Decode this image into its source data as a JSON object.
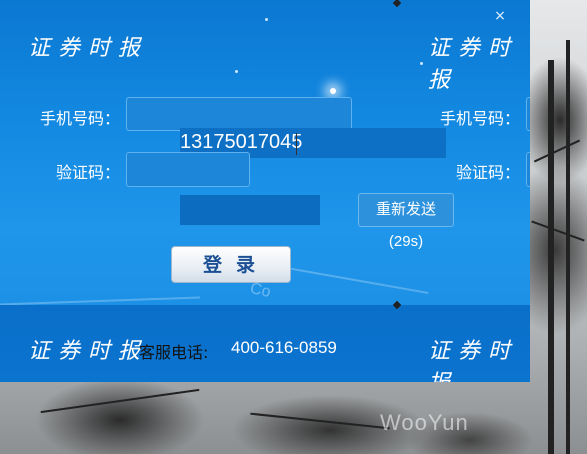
{
  "window": {
    "close_glyph": "×",
    "brand_text": "证券时报"
  },
  "form": {
    "phone_label": "手机号码：",
    "phone_value": "13175017045",
    "code_label": "验证码：",
    "resend_label": "重新发送(29s)",
    "login_label": "登录"
  },
  "duplicate": {
    "phone_label": "手机号码：",
    "code_label": "验证码："
  },
  "footer": {
    "hotline_label": "客服电话:",
    "hotline_number": "400-616-0859"
  },
  "background": {
    "watermark": "WooYun"
  },
  "colors": {
    "window_blue": "#1388e0",
    "footer_blue": "#0b74cf",
    "login_text": "#1a4f94"
  }
}
